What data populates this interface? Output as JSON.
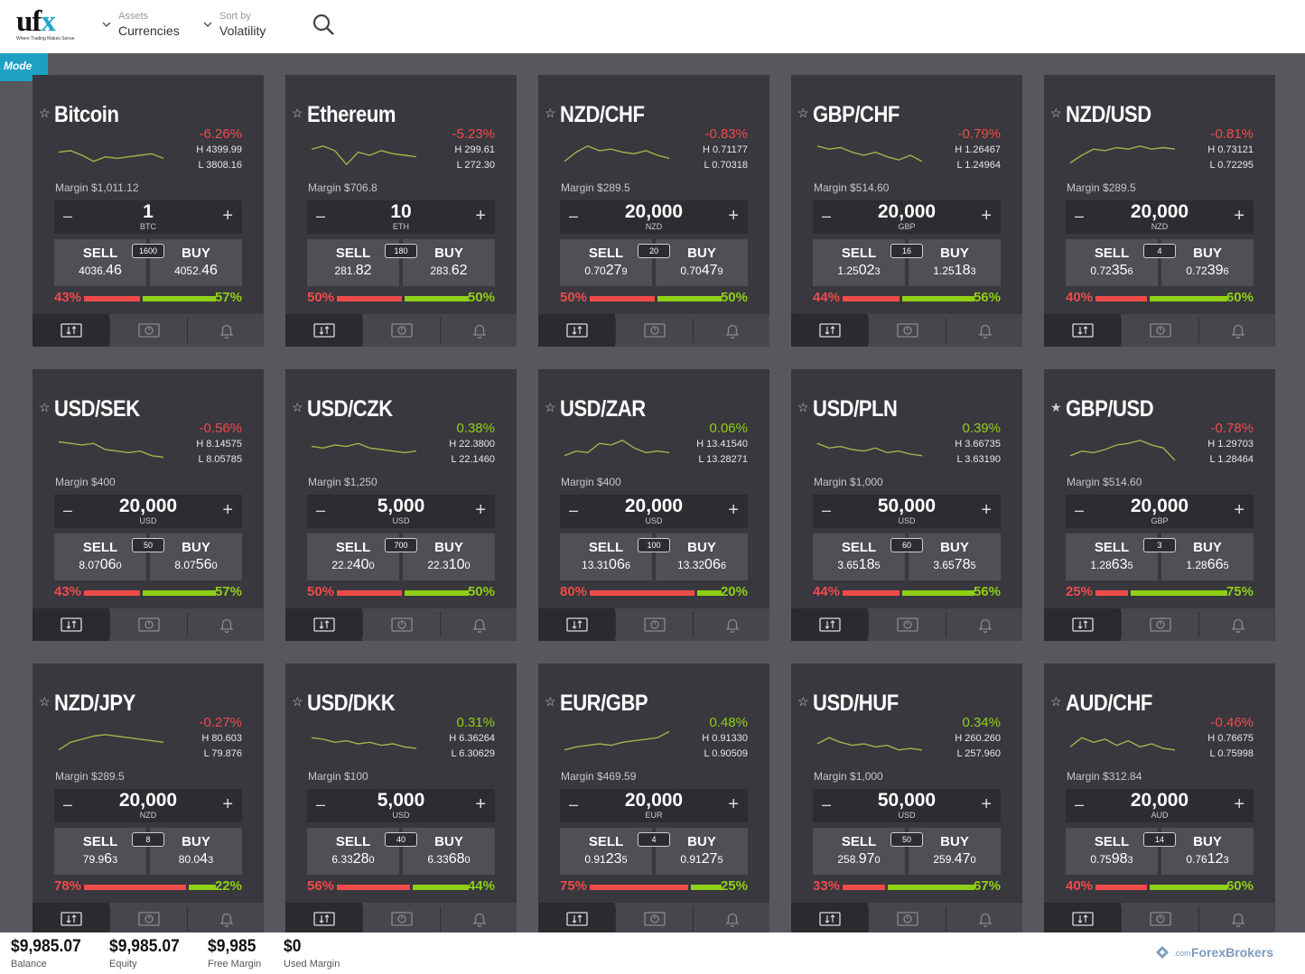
{
  "logo": {
    "brand": "uf",
    "brand_x": "x",
    "tagline": "Where Trading Makes Sense"
  },
  "filters": {
    "assets": {
      "label": "Assets",
      "value": "Currencies"
    },
    "sort": {
      "label": "Sort by",
      "value": "Volatility"
    }
  },
  "mode_label": "Mode",
  "colors": {
    "negative": "#ef4b4b",
    "positive": "#8fd015",
    "accent": "#21a7c6"
  },
  "cards": [
    {
      "name": "Bitcoin",
      "favorite": false,
      "change": "-6.26%",
      "dir": "neg",
      "high": "H 4399.99",
      "low": "L  3808.16",
      "margin": "Margin $1,011.12",
      "amount": "1",
      "unit": "BTC",
      "spread": "1600",
      "sell_main": "4036.",
      "sell_big": "46",
      "sell_tail": "",
      "buy_main": "4052.",
      "buy_big": "46",
      "buy_tail": "",
      "sell_pct": "43%",
      "buy_pct": "57%",
      "sell_ratio": 0.43,
      "spark": [
        0.4,
        0.35,
        0.5,
        0.7,
        0.55,
        0.6,
        0.55,
        0.5,
        0.45,
        0.6
      ]
    },
    {
      "name": "Ethereum",
      "favorite": false,
      "change": "-5.23%",
      "dir": "neg",
      "high": "H  299.61",
      "low": "L  272.30",
      "margin": "Margin $706.8",
      "amount": "10",
      "unit": "ETH",
      "spread": "180",
      "sell_main": "281.",
      "sell_big": "82",
      "sell_tail": "",
      "buy_main": "283.",
      "buy_big": "62",
      "buy_tail": "",
      "sell_pct": "50%",
      "buy_pct": "50%",
      "sell_ratio": 0.5,
      "spark": [
        0.3,
        0.2,
        0.35,
        0.8,
        0.4,
        0.5,
        0.35,
        0.45,
        0.5,
        0.55
      ]
    },
    {
      "name": "NZD/CHF",
      "favorite": false,
      "change": "-0.83%",
      "dir": "neg",
      "high": "H 0.71177",
      "low": "L  0.70318",
      "margin": "Margin $289.5",
      "amount": "20,000",
      "unit": "NZD",
      "spread": "20",
      "sell_main": "0.70",
      "sell_big": "27",
      "sell_tail": "9",
      "buy_main": "0.70",
      "buy_big": "47",
      "buy_tail": "9",
      "sell_pct": "50%",
      "buy_pct": "50%",
      "sell_ratio": 0.5,
      "spark": [
        0.7,
        0.4,
        0.2,
        0.35,
        0.3,
        0.4,
        0.45,
        0.35,
        0.5,
        0.6
      ]
    },
    {
      "name": "GBP/CHF",
      "favorite": false,
      "change": "-0.79%",
      "dir": "neg",
      "high": "H 1.26467",
      "low": "L  1.24964",
      "margin": "Margin $514.60",
      "amount": "20,000",
      "unit": "GBP",
      "spread": "16",
      "sell_main": "1.25",
      "sell_big": "02",
      "sell_tail": "3",
      "buy_main": "1.25",
      "buy_big": "18",
      "buy_tail": "3",
      "sell_pct": "44%",
      "buy_pct": "56%",
      "sell_ratio": 0.44,
      "spark": [
        0.2,
        0.3,
        0.25,
        0.4,
        0.5,
        0.4,
        0.55,
        0.65,
        0.5,
        0.7
      ]
    },
    {
      "name": "NZD/USD",
      "favorite": false,
      "change": "-0.81%",
      "dir": "neg",
      "high": "H 0.73121",
      "low": "L  0.72295",
      "margin": "Margin $289.5",
      "amount": "20,000",
      "unit": "NZD",
      "spread": "4",
      "sell_main": "0.72",
      "sell_big": "35",
      "sell_tail": "6",
      "buy_main": "0.72",
      "buy_big": "39",
      "buy_tail": "6",
      "sell_pct": "40%",
      "buy_pct": "60%",
      "sell_ratio": 0.4,
      "spark": [
        0.75,
        0.5,
        0.3,
        0.35,
        0.25,
        0.3,
        0.2,
        0.3,
        0.25,
        0.3
      ]
    },
    {
      "name": "USD/SEK",
      "favorite": false,
      "change": "-0.56%",
      "dir": "neg",
      "high": "H 8.14575",
      "low": "L  8.05785",
      "margin": "Margin $400",
      "amount": "20,000",
      "unit": "USD",
      "spread": "50",
      "sell_main": "8.07",
      "sell_big": "06",
      "sell_tail": "0",
      "buy_main": "8.07",
      "buy_big": "56",
      "buy_tail": "0",
      "sell_pct": "43%",
      "buy_pct": "57%",
      "sell_ratio": 0.43,
      "spark": [
        0.25,
        0.3,
        0.35,
        0.3,
        0.5,
        0.55,
        0.6,
        0.55,
        0.7,
        0.75
      ]
    },
    {
      "name": "USD/CZK",
      "favorite": false,
      "change": "0.38%",
      "dir": "pos",
      "high": "H 22.3800",
      "low": "L  22.1460",
      "margin": "Margin $1,250",
      "amount": "5,000",
      "unit": "USD",
      "spread": "700",
      "sell_main": "22.2",
      "sell_big": "40",
      "sell_tail": "0",
      "buy_main": "22.3",
      "buy_big": "10",
      "buy_tail": "0",
      "sell_pct": "50%",
      "buy_pct": "50%",
      "sell_ratio": 0.5,
      "spark": [
        0.4,
        0.45,
        0.35,
        0.4,
        0.3,
        0.45,
        0.5,
        0.55,
        0.6,
        0.55
      ]
    },
    {
      "name": "USD/ZAR",
      "favorite": false,
      "change": "0.06%",
      "dir": "pos",
      "high": "H 13.41540",
      "low": "L  13.28271",
      "margin": "Margin $400",
      "amount": "20,000",
      "unit": "USD",
      "spread": "100",
      "sell_main": "13.31",
      "sell_big": "06",
      "sell_tail": "6",
      "buy_main": "13.32",
      "buy_big": "06",
      "buy_tail": "6",
      "sell_pct": "80%",
      "buy_pct": "20%",
      "sell_ratio": 0.8,
      "spark": [
        0.7,
        0.55,
        0.6,
        0.3,
        0.35,
        0.2,
        0.45,
        0.6,
        0.55,
        0.6
      ]
    },
    {
      "name": "USD/PLN",
      "favorite": false,
      "change": "0.39%",
      "dir": "pos",
      "high": "H 3.66735",
      "low": "L  3.63190",
      "margin": "Margin $1,000",
      "amount": "50,000",
      "unit": "USD",
      "spread": "60",
      "sell_main": "3.65",
      "sell_big": "18",
      "sell_tail": "5",
      "buy_main": "3.65",
      "buy_big": "78",
      "buy_tail": "5",
      "sell_pct": "44%",
      "buy_pct": "56%",
      "sell_ratio": 0.44,
      "spark": [
        0.3,
        0.45,
        0.4,
        0.5,
        0.55,
        0.45,
        0.6,
        0.55,
        0.65,
        0.7
      ]
    },
    {
      "name": "GBP/USD",
      "favorite": true,
      "change": "-0.78%",
      "dir": "neg",
      "high": "H 1.29703",
      "low": "L  1.28464",
      "margin": "Margin $514.60",
      "amount": "20,000",
      "unit": "GBP",
      "spread": "3",
      "sell_main": "1.28",
      "sell_big": "63",
      "sell_tail": "5",
      "buy_main": "1.28",
      "buy_big": "66",
      "buy_tail": "5",
      "sell_pct": "25%",
      "buy_pct": "75%",
      "sell_ratio": 0.25,
      "spark": [
        0.7,
        0.55,
        0.6,
        0.5,
        0.35,
        0.3,
        0.2,
        0.35,
        0.45,
        0.85
      ]
    },
    {
      "name": "NZD/JPY",
      "favorite": false,
      "change": "-0.27%",
      "dir": "neg",
      "high": "H 80.603",
      "low": "L  79.876",
      "margin": "Margin $289.5",
      "amount": "20,000",
      "unit": "NZD",
      "spread": "8",
      "sell_main": "79.9",
      "sell_big": "6",
      "sell_tail": "3",
      "buy_main": "80.0",
      "buy_big": "4",
      "buy_tail": "3",
      "sell_pct": "78%",
      "buy_pct": "22%",
      "sell_ratio": 0.78,
      "spark": [
        0.7,
        0.45,
        0.35,
        0.25,
        0.2,
        0.25,
        0.3,
        0.35,
        0.4,
        0.45
      ]
    },
    {
      "name": "USD/DKK",
      "favorite": false,
      "change": "0.31%",
      "dir": "pos",
      "high": "H 6.36264",
      "low": "L  6.30629",
      "margin": "Margin $100",
      "amount": "5,000",
      "unit": "USD",
      "spread": "40",
      "sell_main": "6.33",
      "sell_big": "28",
      "sell_tail": "0",
      "buy_main": "6.33",
      "buy_big": "68",
      "buy_tail": "0",
      "sell_pct": "56%",
      "buy_pct": "44%",
      "sell_ratio": 0.56,
      "spark": [
        0.3,
        0.35,
        0.45,
        0.4,
        0.5,
        0.45,
        0.55,
        0.5,
        0.6,
        0.65
      ]
    },
    {
      "name": "EUR/GBP",
      "favorite": false,
      "change": "0.48%",
      "dir": "pos",
      "high": "H 0.91330",
      "low": "L  0.90509",
      "margin": "Margin $469.59",
      "amount": "20,000",
      "unit": "EUR",
      "spread": "4",
      "sell_main": "0.91",
      "sell_big": "23",
      "sell_tail": "5",
      "buy_main": "0.91",
      "buy_big": "27",
      "buy_tail": "5",
      "sell_pct": "75%",
      "buy_pct": "25%",
      "sell_ratio": 0.75,
      "spark": [
        0.7,
        0.6,
        0.55,
        0.5,
        0.55,
        0.45,
        0.4,
        0.35,
        0.3,
        0.1
      ]
    },
    {
      "name": "USD/HUF",
      "favorite": false,
      "change": "0.34%",
      "dir": "pos",
      "high": "H 260.260",
      "low": "L  257.960",
      "margin": "Margin $1,000",
      "amount": "50,000",
      "unit": "USD",
      "spread": "50",
      "sell_main": "258.",
      "sell_big": "97",
      "sell_tail": "0",
      "buy_main": "259.",
      "buy_big": "47",
      "buy_tail": "0",
      "sell_pct": "33%",
      "buy_pct": "67%",
      "sell_ratio": 0.33,
      "spark": [
        0.5,
        0.3,
        0.45,
        0.55,
        0.5,
        0.6,
        0.55,
        0.7,
        0.65,
        0.7
      ]
    },
    {
      "name": "AUD/CHF",
      "favorite": false,
      "change": "-0.46%",
      "dir": "neg",
      "high": "H 0.76675",
      "low": "L  0.75998",
      "margin": "Margin $312.84",
      "amount": "20,000",
      "unit": "AUD",
      "spread": "14",
      "sell_main": "0.75",
      "sell_big": "98",
      "sell_tail": "3",
      "buy_main": "0.76",
      "buy_big": "12",
      "buy_tail": "3",
      "sell_pct": "40%",
      "buy_pct": "60%",
      "sell_ratio": 0.4,
      "spark": [
        0.6,
        0.3,
        0.45,
        0.35,
        0.55,
        0.4,
        0.6,
        0.5,
        0.65,
        0.7
      ]
    }
  ],
  "footer": {
    "balance": {
      "value": "$9,985.07",
      "label": "Balance"
    },
    "equity": {
      "value": "$9,985.07",
      "label": "Equity"
    },
    "free_margin": {
      "value": "$9,985",
      "label": "Free Margin"
    },
    "used_margin": {
      "value": "$0",
      "label": "Used Margin"
    }
  },
  "watermark": {
    "brand": "ForexBrokers",
    "suffix": ".com"
  }
}
